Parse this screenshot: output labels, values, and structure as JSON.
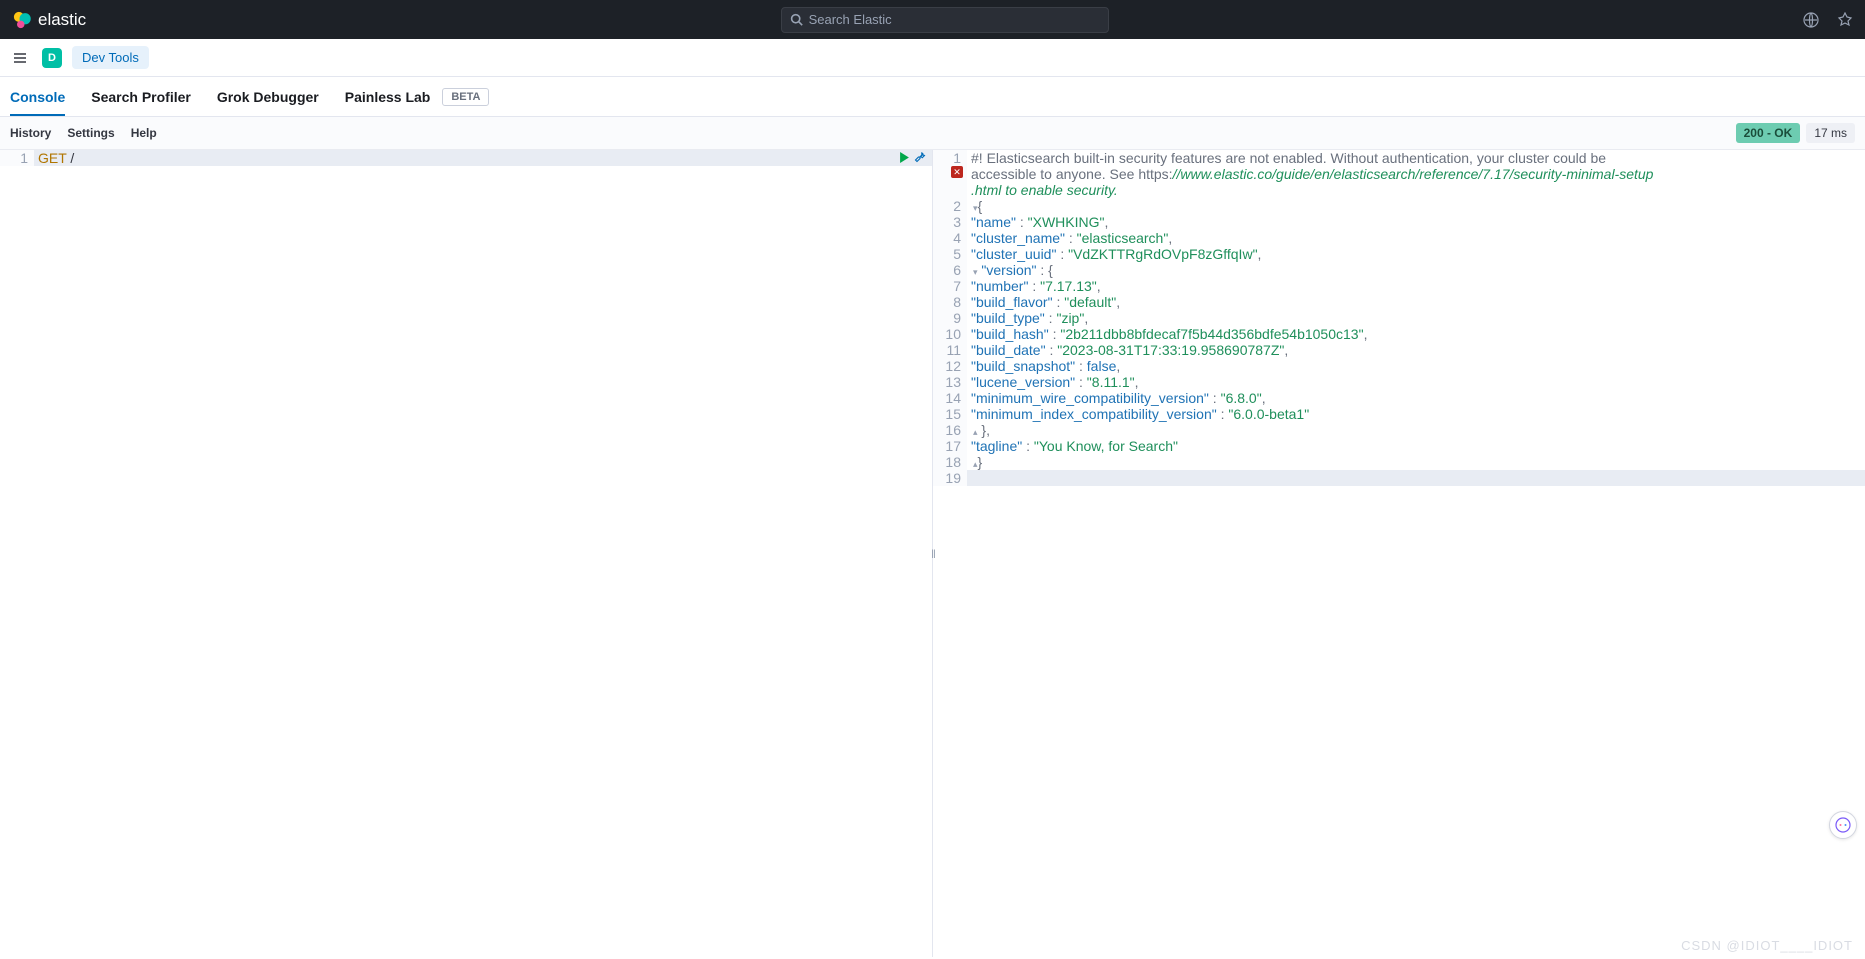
{
  "header": {
    "logo_text": "elastic",
    "search_placeholder": "Search Elastic"
  },
  "subheader": {
    "app_letter": "D",
    "breadcrumb": "Dev Tools"
  },
  "tabs": [
    {
      "label": "Console",
      "active": true
    },
    {
      "label": "Search Profiler",
      "active": false
    },
    {
      "label": "Grok Debugger",
      "active": false
    },
    {
      "label": "Painless Lab",
      "active": false,
      "beta": "BETA"
    }
  ],
  "toolbar": {
    "history": "History",
    "settings": "Settings",
    "help": "Help",
    "status": "200 - OK",
    "timing": "17 ms"
  },
  "request": {
    "line_num": "1",
    "method": "GET",
    "path": "/"
  },
  "response": {
    "warning_prefix": "#! Elasticsearch built-in security features are not enabled. Without authentication, your cluster could be ",
    "warning_line2a": "accessible to anyone. See https:",
    "warning_url": "//www.elastic.co/guide/en/elasticsearch/reference/7.17/security-minimal-setup",
    "warning_line3": ".html to enable security.",
    "error_icon": "✕",
    "body": {
      "name": "XWHKING",
      "cluster_name": "elasticsearch",
      "cluster_uuid": "VdZKTTRgRdOVpF8zGffqIw",
      "version_number": "7.17.13",
      "build_flavor": "default",
      "build_type": "zip",
      "build_hash": "2b211dbb8bfdecaf7f5b44d356bdfe54b1050c13",
      "build_date": "2023-08-31T17:33:19.958690787Z",
      "build_snapshot": "false",
      "lucene_version": "8.11.1",
      "min_wire": "6.8.0",
      "min_index": "6.0.0-beta1",
      "tagline": "You Know, for Search"
    },
    "line_nums": [
      "1",
      "2",
      "3",
      "4",
      "5",
      "6",
      "7",
      "8",
      "9",
      "10",
      "11",
      "12",
      "13",
      "14",
      "15",
      "16",
      "17",
      "18",
      "19"
    ]
  },
  "watermark": "CSDN @IDIOT____IDIOT"
}
